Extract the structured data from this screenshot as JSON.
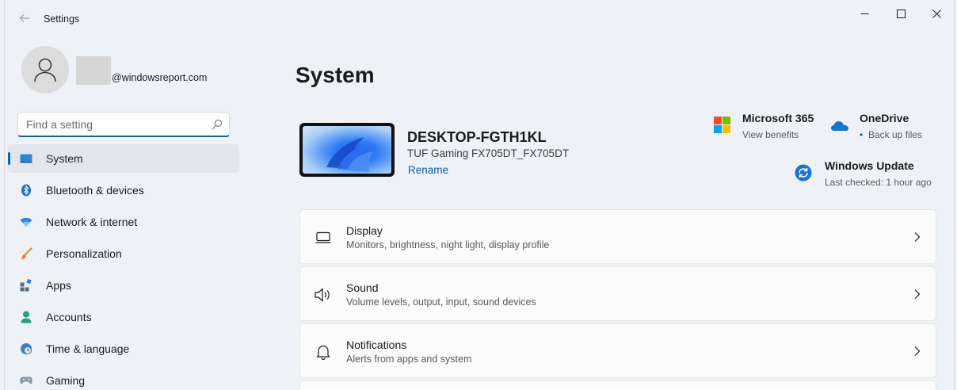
{
  "window": {
    "title": "Settings"
  },
  "account": {
    "email": "@windowsreport.com"
  },
  "search": {
    "placeholder": "Find a setting",
    "value": ""
  },
  "sidebar": {
    "items": [
      {
        "label": "System",
        "icon": "system-icon",
        "active": true
      },
      {
        "label": "Bluetooth & devices",
        "icon": "bluetooth-icon"
      },
      {
        "label": "Network & internet",
        "icon": "wifi-icon"
      },
      {
        "label": "Personalization",
        "icon": "brush-icon"
      },
      {
        "label": "Apps",
        "icon": "apps-icon"
      },
      {
        "label": "Accounts",
        "icon": "person-icon"
      },
      {
        "label": "Time & language",
        "icon": "clock-globe-icon"
      },
      {
        "label": "Gaming",
        "icon": "gamepad-icon"
      }
    ]
  },
  "main": {
    "title": "System",
    "device": {
      "name": "DESKTOP-FGTH1KL",
      "model": "TUF Gaming FX705DT_FX705DT",
      "rename_label": "Rename"
    },
    "quick_links": {
      "m365": {
        "title": "Microsoft 365",
        "subtitle": "View benefits"
      },
      "onedrive": {
        "title": "OneDrive",
        "subtitle": "Back up files"
      },
      "update": {
        "title": "Windows Update",
        "subtitle": "Last checked: 1 hour ago"
      }
    },
    "settings": [
      {
        "title": "Display",
        "subtitle": "Monitors, brightness, night light, display profile",
        "icon": "monitor-icon"
      },
      {
        "title": "Sound",
        "subtitle": "Volume levels, output, input, sound devices",
        "icon": "speaker-icon"
      },
      {
        "title": "Notifications",
        "subtitle": "Alerts from apps and system",
        "icon": "bell-icon"
      }
    ]
  },
  "colors": {
    "accent": "#0067c0",
    "background": "#eef2f7",
    "link": "#0a5aa8"
  }
}
